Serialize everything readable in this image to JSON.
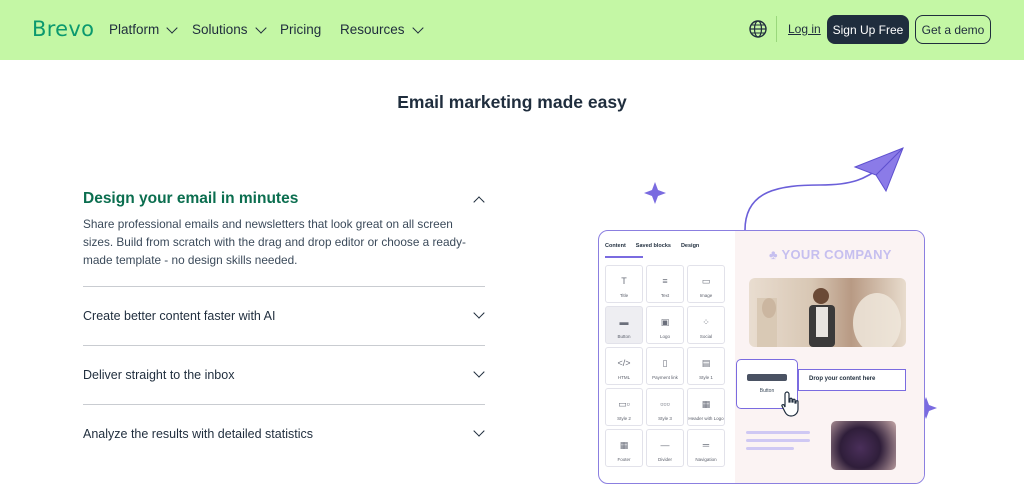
{
  "nav": {
    "brand": "Brevo",
    "menu": [
      {
        "label": "Platform",
        "dropdown": true
      },
      {
        "label": "Solutions",
        "dropdown": true
      },
      {
        "label": "Pricing",
        "dropdown": false
      },
      {
        "label": "Resources",
        "dropdown": true
      }
    ],
    "language_icon": "globe-icon",
    "login": "Log in",
    "signup": "Sign Up Free",
    "demo": "Get a demo"
  },
  "headline": "Email marketing made easy",
  "accordion": [
    {
      "title": "Design your email in minutes",
      "expanded": true,
      "description": "Share professional emails and newsletters that look great on all screen sizes. Build from scratch with the drag and drop editor or choose a ready-made template - no design skills needed."
    },
    {
      "title": "Create better content faster with AI",
      "expanded": false
    },
    {
      "title": "Deliver straight to the inbox",
      "expanded": false
    },
    {
      "title": "Analyze the results with detailed statistics",
      "expanded": false
    }
  ],
  "editor": {
    "tabs": [
      "Content",
      "Saved blocks",
      "Design"
    ],
    "blocks": [
      {
        "label": "Title",
        "icon": "title-icon"
      },
      {
        "label": "Text",
        "icon": "text-icon"
      },
      {
        "label": "Image",
        "icon": "image-icon"
      },
      {
        "label": "Button",
        "icon": "button-icon"
      },
      {
        "label": "Logo",
        "icon": "logo-icon"
      },
      {
        "label": "Social",
        "icon": "social-icon"
      },
      {
        "label": "HTML",
        "icon": "code-icon"
      },
      {
        "label": "Payment link",
        "icon": "payment-icon"
      },
      {
        "label": "Style 1",
        "icon": "layout-icon"
      },
      {
        "label": "Style 2",
        "icon": "layout-icon"
      },
      {
        "label": "Style 3",
        "icon": "layout-icon"
      },
      {
        "label": "Header with Logo",
        "icon": "header-icon"
      },
      {
        "label": "Footer",
        "icon": "footer-icon"
      },
      {
        "label": "Divider",
        "icon": "divider-icon"
      },
      {
        "label": "Navigation",
        "icon": "navigation-icon"
      }
    ],
    "company": "YOUR COMPANY",
    "button_label": "Button",
    "drop_text": "Drop your content here"
  },
  "colors": {
    "nav_bg": "#c4f7a5",
    "brand": "#0b996e",
    "dark": "#1f2d3d",
    "accent": "#7a6be0",
    "open_title": "#0b6e4f"
  }
}
